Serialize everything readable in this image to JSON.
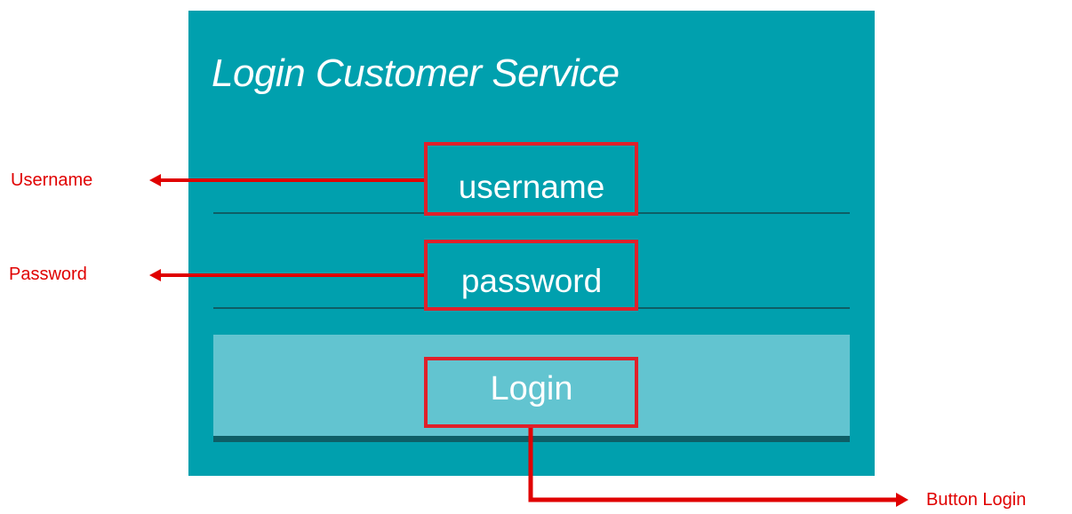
{
  "form": {
    "title": "Login Customer Service",
    "username_placeholder": "username",
    "password_placeholder": "password",
    "login_label": "Login"
  },
  "annotations": {
    "username": "Username",
    "password": "Password",
    "login": "Button Login"
  },
  "colors": {
    "panel": "#00A0AE",
    "button": "#62C4D0",
    "underline": "#0E5E66",
    "highlight": "#E0202A",
    "annotation_text": "#E00000"
  }
}
